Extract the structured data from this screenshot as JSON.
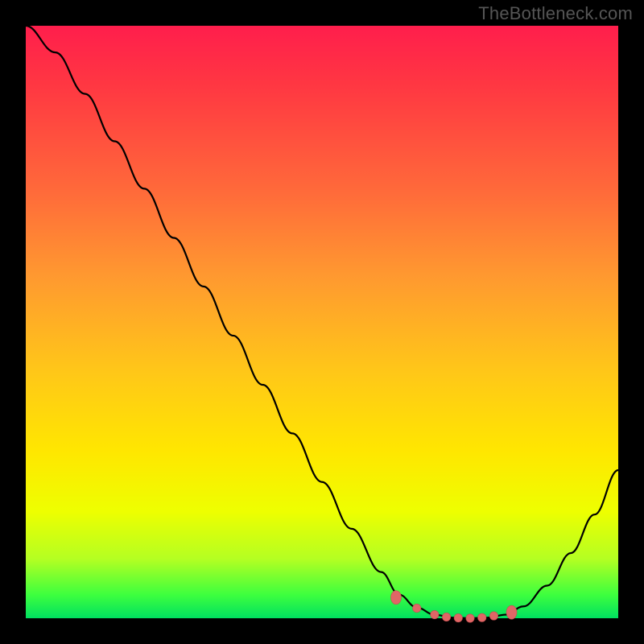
{
  "watermark": "TheBottleneck.com",
  "colors": {
    "background": "#000000",
    "curve": "#000000",
    "marker": "#e06666",
    "gradient_top": "#ff1e4c",
    "gradient_bottom": "#00e060"
  },
  "chart_data": {
    "type": "line",
    "title": "",
    "xlabel": "",
    "ylabel": "",
    "x": [
      0.0,
      0.05,
      0.1,
      0.15,
      0.2,
      0.25,
      0.3,
      0.35,
      0.4,
      0.45,
      0.5,
      0.55,
      0.6,
      0.63,
      0.66,
      0.69,
      0.72,
      0.75,
      0.78,
      0.81,
      0.84,
      0.88,
      0.92,
      0.96,
      1.0
    ],
    "series": [
      {
        "name": "bottleneck-curve",
        "values": [
          1.0,
          0.955,
          0.885,
          0.805,
          0.725,
          0.642,
          0.56,
          0.477,
          0.394,
          0.312,
          0.23,
          0.151,
          0.078,
          0.04,
          0.018,
          0.006,
          0.001,
          0.0,
          0.001,
          0.006,
          0.02,
          0.055,
          0.11,
          0.175,
          0.25
        ]
      }
    ],
    "markers": {
      "name": "highlight-points",
      "x": [
        0.625,
        0.66,
        0.69,
        0.71,
        0.73,
        0.75,
        0.77,
        0.79,
        0.82
      ],
      "y": [
        0.035,
        0.017,
        0.006,
        0.002,
        0.0005,
        0.0,
        0.001,
        0.004,
        0.01
      ]
    },
    "xlim": [
      0,
      1
    ],
    "ylim": [
      0,
      1
    ],
    "grid": false,
    "legend": false
  }
}
